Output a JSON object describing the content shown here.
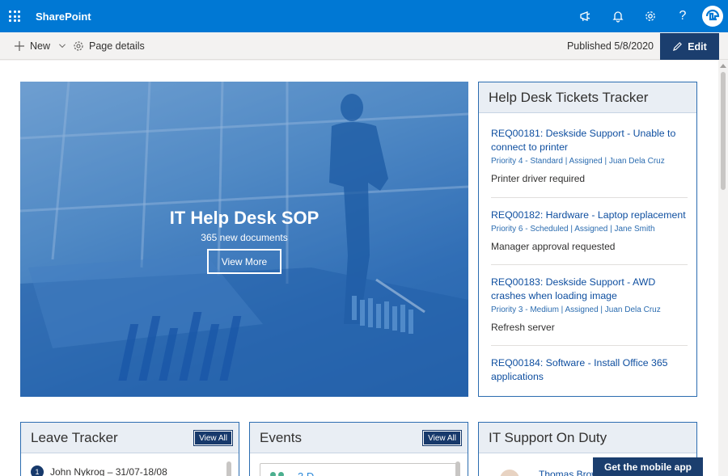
{
  "suite_bar": {
    "app_name": "SharePoint",
    "help_glyph": "?",
    "icons": [
      "waffle-icon",
      "megaphone-icon",
      "bell-icon",
      "gear-icon",
      "help-icon",
      "avatar"
    ],
    "accent": "#0078d4"
  },
  "command_bar": {
    "new_label": "New",
    "page_details_label": "Page details",
    "published": "Published 5/8/2020",
    "edit_label": "Edit"
  },
  "hero": {
    "title": "IT Help Desk SOP",
    "subtitle": "365 new documents",
    "button": "View More"
  },
  "tickets": {
    "title": "Help Desk Tickets Tracker",
    "items": [
      {
        "title": "REQ00181: Deskside Support - Unable to connect to printer",
        "meta": "Priority 4 - Standard | Assigned | Juan Dela Cruz",
        "note": "Printer driver required"
      },
      {
        "title": "REQ00182: Hardware - Laptop replacement",
        "meta": "Priority 6 - Scheduled | Assigned | Jane Smith",
        "note": "Manager approval requested"
      },
      {
        "title": "REQ00183: Deskside Support - AWD crashes when loading image",
        "meta": "Priority 3 - Medium | Assigned | Juan Dela Cruz",
        "note": "Refresh server"
      },
      {
        "title": "REQ00184: Software - Install Office 365 applications",
        "meta": "",
        "note": ""
      }
    ]
  },
  "leave_tracker": {
    "title": "Leave Tracker",
    "view_all": "View All",
    "rows": [
      {
        "num": "1",
        "text": "John Nykrog – 31/07-18/08"
      }
    ]
  },
  "events": {
    "title": "Events",
    "view_all": "View All",
    "first_item": "3 D"
  },
  "it_support": {
    "title": "IT Support On Duty",
    "person": "Thomas Brow"
  },
  "mobile_app_button": "Get the mobile app"
}
